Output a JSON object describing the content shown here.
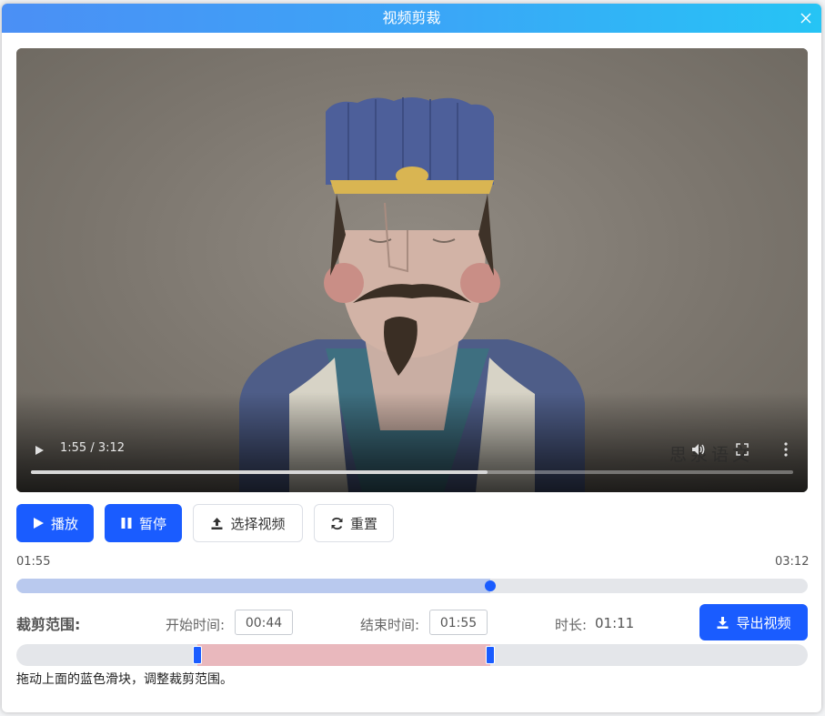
{
  "dialog": {
    "title": "视频剪裁"
  },
  "video": {
    "time_display": "1:55 / 3:12",
    "watermark": "思泉语文",
    "progress_fraction": 0.599
  },
  "buttons": {
    "play": "播放",
    "pause": "暂停",
    "select_video": "选择视频",
    "reset": "重置",
    "export": "导出视频"
  },
  "timeline": {
    "current": "01:55",
    "total": "03:12",
    "progress_fraction": 0.599
  },
  "crop": {
    "label": "裁剪范围:",
    "start_label": "开始时间:",
    "start_value": "00:44",
    "end_label": "结束时间:",
    "end_value": "01:55",
    "duration_label": "时长:",
    "duration_value": "01:11",
    "start_fraction": 0.229,
    "end_fraction": 0.599,
    "hint": "拖动上面的蓝色滑块，调整裁剪范围。"
  },
  "colors": {
    "primary": "#1a5cff",
    "title_gradient_start": "#4b8ff5",
    "title_gradient_end": "#26c4f5",
    "selected_range": "#e9b8bd",
    "played_range": "#b9c9ee"
  },
  "icons": {
    "close": "close-icon",
    "play": "play-icon",
    "pause": "pause-icon",
    "upload": "upload-icon",
    "refresh": "refresh-icon",
    "download": "download-icon",
    "volume": "volume-icon",
    "fullscreen": "fullscreen-icon",
    "more": "more-vertical-icon"
  }
}
